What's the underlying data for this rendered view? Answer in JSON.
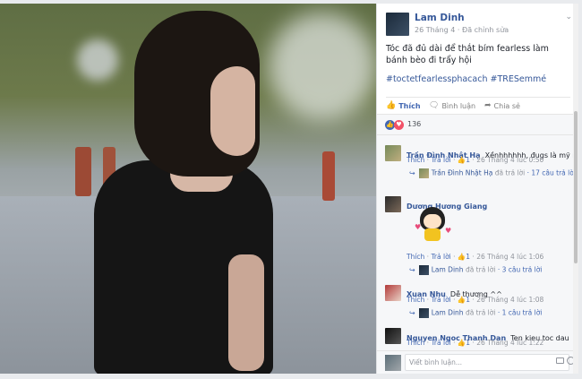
{
  "post": {
    "author": "Lam Dinh",
    "date": "26 Tháng 4",
    "edited": "Đã chỉnh sửa",
    "text": "Tóc đã đủ dài để thắt bím fearless làm bánh bèo đi trẩy hội",
    "hashtags": "#toctetfearlessphacach #TRESemmé",
    "actions": {
      "like": "Thích",
      "comment": "Bình luận",
      "share": "Chia sẻ"
    },
    "reaction_count": "136"
  },
  "comments": [
    {
      "name": "Trần Đình Nhật Hạ",
      "text": "Xềnhhhhhh, đugs là mỹ nhon",
      "like": "Thích",
      "reply": "Trả lời",
      "likes": "1",
      "time": "26 Tháng 4 lúc 0:50",
      "reply_summary": {
        "name": "Trần Đình Nhật Hạ",
        "action": "đã trả lời",
        "count": "17 câu trả lời"
      }
    },
    {
      "name": "Dương Hương Giang",
      "text": "",
      "like": "Thích",
      "reply": "Trả lời",
      "likes": "1",
      "time": "26 Tháng 4 lúc 1:06",
      "reply_summary": {
        "name": "Lam Dinh",
        "action": "đã trả lời",
        "count": "3 câu trả lời"
      }
    },
    {
      "name": "Xuan Nhu",
      "text": "Dễ thương ^^",
      "like": "Thích",
      "reply": "Trả lời",
      "likes": "1",
      "time": "26 Tháng 4 lúc 1:08",
      "reply_summary": {
        "name": "Lam Dinh",
        "action": "đã trả lời",
        "count": "1 câu trả lời"
      }
    },
    {
      "name": "Nguyen Ngoc Thanh Dan",
      "text": "Ten kieu toc dau",
      "like": "Thích",
      "reply": "Trả lời",
      "likes": "1",
      "time": "26 Tháng 4 lúc 1:22"
    }
  ],
  "composer": {
    "placeholder": "Viết bình luận..."
  },
  "icons": [
    "like-icon",
    "comment-icon",
    "share-icon",
    "camera-icon",
    "emoji-icon",
    "chevron-down-icon",
    "reply-arrow-icon"
  ],
  "colors": {
    "link": "#365899",
    "accent": "#4267b2",
    "muted": "#90949c"
  }
}
